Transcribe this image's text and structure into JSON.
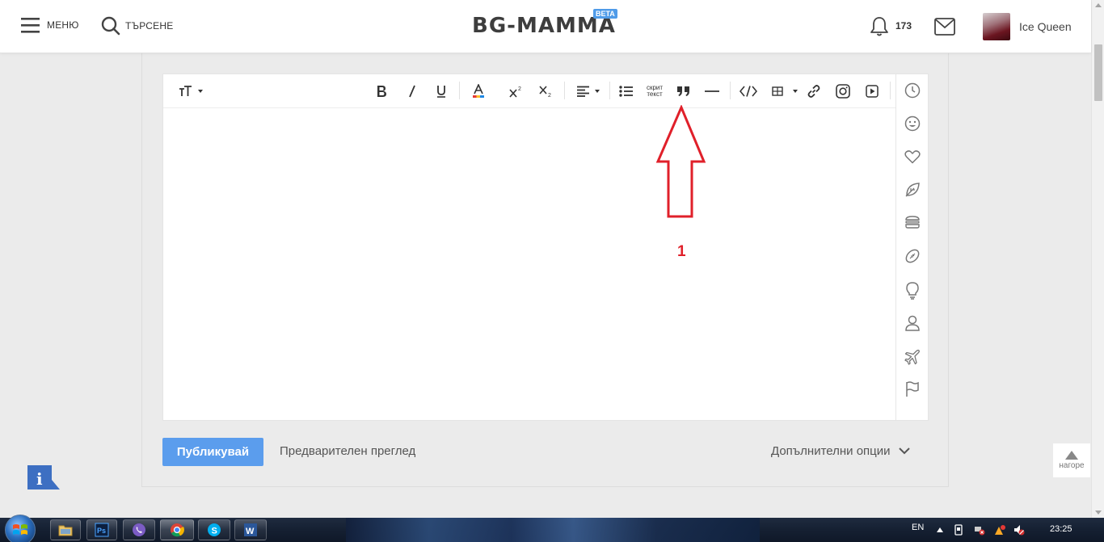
{
  "header": {
    "menu_label": "МЕНЮ",
    "search_label": "ТЪРСЕНЕ",
    "logo_text": "BG-MAMMA",
    "logo_badge": "BETA",
    "notifications_count": "173",
    "username": "Ice Queen"
  },
  "toolbar": {
    "items": [
      "font-size",
      "bold",
      "italic",
      "underline",
      "text-color",
      "superscript",
      "subscript",
      "align",
      "bullet-list",
      "hidden-text",
      "quote",
      "horizontal-rule",
      "code",
      "table",
      "link",
      "instagram",
      "video"
    ],
    "hidden_text_line1": "скрит",
    "hidden_text_line2": "текст"
  },
  "side_icons": [
    "clock-icon",
    "smiley-icon",
    "heart-icon",
    "leaf-icon",
    "burger-icon",
    "football-icon",
    "bulb-icon",
    "person-icon",
    "plane-icon",
    "flag-icon"
  ],
  "actions": {
    "publish_label": "Публикувай",
    "preview_label": "Предварителен преглед",
    "extra_options_label": "Допълнителни опции"
  },
  "annotation": {
    "number": "1",
    "color": "#e0202a"
  },
  "scroll_top": {
    "label": "нагоре"
  },
  "taskbar": {
    "apps": [
      "explorer",
      "photoshop",
      "viber",
      "chrome",
      "skype",
      "word"
    ],
    "language": "EN",
    "time": "23:25"
  },
  "colors": {
    "accent": "#5b9ded",
    "badge": "#4f9be8"
  }
}
